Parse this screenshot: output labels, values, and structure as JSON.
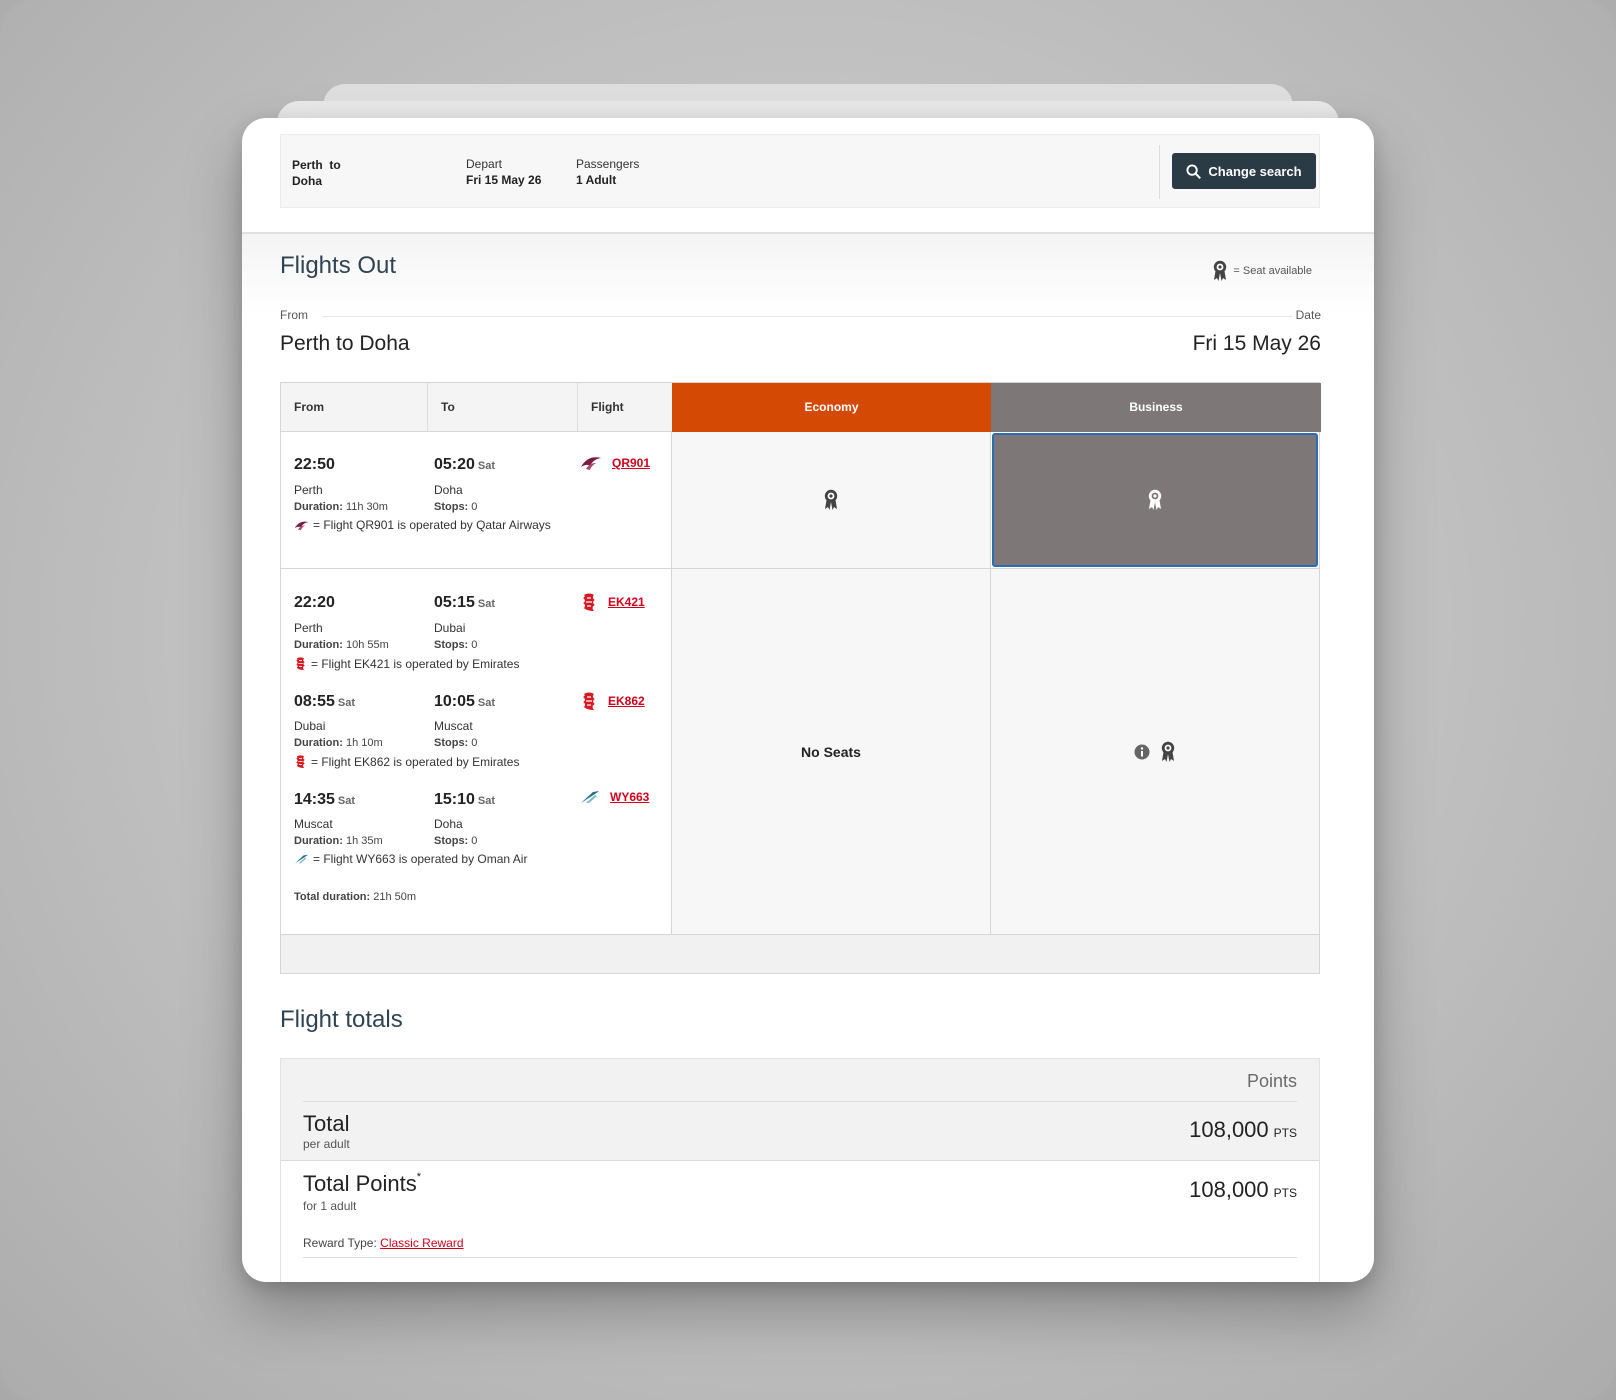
{
  "search_summary": {
    "route_line1": "Perth  to",
    "route_line2": "Doha",
    "depart_label": "Depart",
    "depart_value": "Fri 15 May 26",
    "passengers_label": "Passengers",
    "passengers_value": "1 Adult",
    "change_button": "Change search"
  },
  "flights_out": {
    "title": "Flights Out",
    "legend_text": "= Seat available",
    "from_label": "From",
    "date_label": "Date",
    "route": "Perth to Doha",
    "date": "Fri 15 May 26"
  },
  "table": {
    "headers": {
      "from": "From",
      "to": "To",
      "flight": "Flight",
      "economy": "Economy",
      "business": "Business"
    },
    "colors": {
      "economy": "#d44a05",
      "business": "#7e7778",
      "selected_border": "#2a6db5"
    },
    "rows": [
      {
        "segments": [
          {
            "dep_time": "22:50",
            "dep_day": "",
            "arr_time": "05:20",
            "arr_day": "Sat",
            "from_city": "Perth",
            "to_city": "Doha",
            "duration_label": "Duration:",
            "duration": "11h 30m",
            "stops_label": "Stops:",
            "stops": "0",
            "flight": "QR901",
            "airline_icon": "qatar-airways-icon",
            "operated_by": "= Flight QR901 is operated by Qatar Airways"
          }
        ],
        "economy": {
          "icon": "seat-available-icon"
        },
        "business": {
          "icon": "seat-available-icon",
          "selected": true
        }
      },
      {
        "segments": [
          {
            "dep_time": "22:20",
            "dep_day": "",
            "arr_time": "05:15",
            "arr_day": "Sat",
            "from_city": "Perth",
            "to_city": "Dubai",
            "duration_label": "Duration:",
            "duration": "10h 55m",
            "stops_label": "Stops:",
            "stops": "0",
            "flight": "EK421",
            "airline_icon": "emirates-icon",
            "operated_by": "= Flight EK421 is operated by Emirates"
          },
          {
            "dep_time": "08:55",
            "dep_day": "Sat",
            "arr_time": "10:05",
            "arr_day": "Sat",
            "from_city": "Dubai",
            "to_city": "Muscat",
            "duration_label": "Duration:",
            "duration": "1h 10m",
            "stops_label": "Stops:",
            "stops": "0",
            "flight": "EK862",
            "airline_icon": "emirates-icon",
            "operated_by": "= Flight EK862 is operated by Emirates"
          },
          {
            "dep_time": "14:35",
            "dep_day": "Sat",
            "arr_time": "15:10",
            "arr_day": "Sat",
            "from_city": "Muscat",
            "to_city": "Doha",
            "duration_label": "Duration:",
            "duration": "1h 35m",
            "stops_label": "Stops:",
            "stops": "0",
            "flight": "WY663",
            "airline_icon": "oman-air-icon",
            "operated_by": "= Flight WY663 is operated by Oman Air"
          }
        ],
        "total_duration_label": "Total duration:",
        "total_duration": "21h 50m",
        "economy": {
          "text": "No Seats"
        },
        "business": {
          "icons": [
            "info-icon",
            "seat-available-icon"
          ]
        }
      }
    ]
  },
  "totals": {
    "title": "Flight totals",
    "points_header": "Points",
    "total_label": "Total",
    "total_sub": "per adult",
    "total_value": "108,000",
    "total_unit": "PTS",
    "total_points_label": "Total Points",
    "total_points_mark": "*",
    "total_points_sub": "for 1 adult",
    "total_points_value": "108,000",
    "total_points_unit": "PTS",
    "reward_label": "Reward Type:",
    "reward_value": "Classic Reward"
  }
}
